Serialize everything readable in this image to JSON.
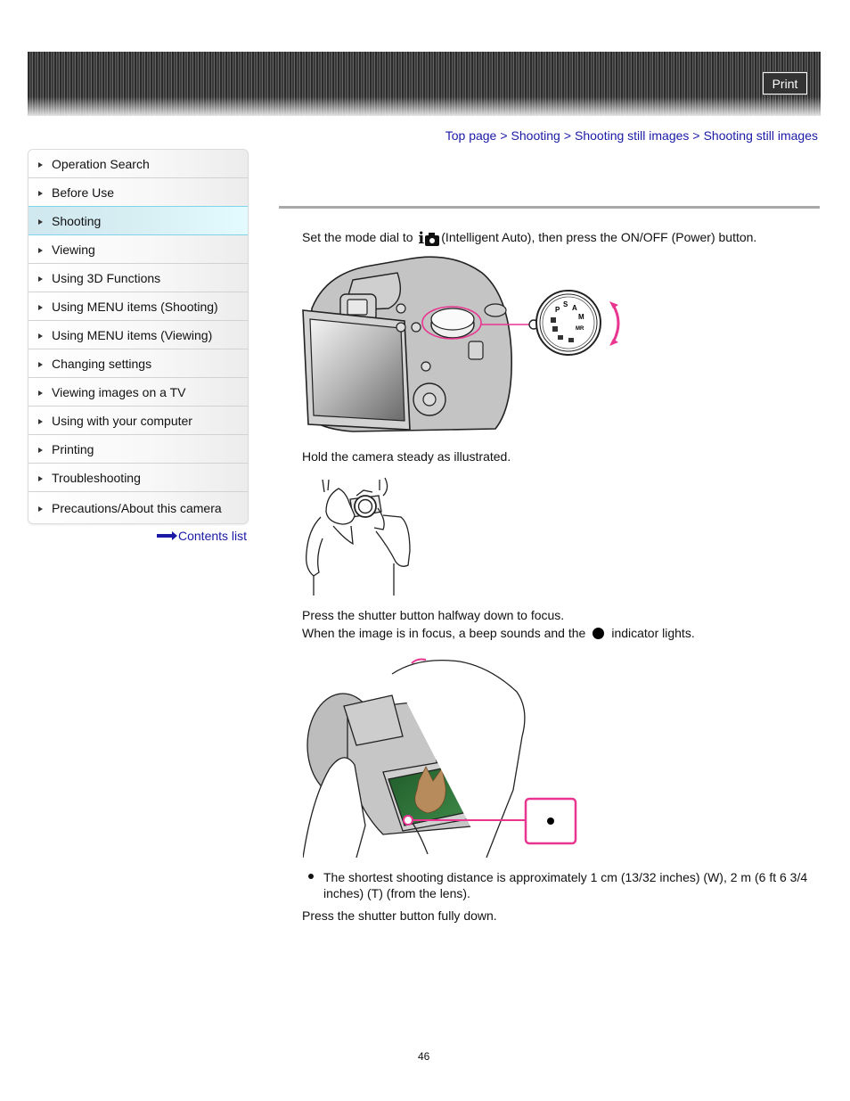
{
  "header": {
    "print_label": "Print"
  },
  "breadcrumb": {
    "items": [
      "Top page",
      "Shooting",
      "Shooting still images",
      "Shooting still images"
    ],
    "separator": ">"
  },
  "sidebar": {
    "items": [
      {
        "label": "Operation Search",
        "active": false
      },
      {
        "label": "Before Use",
        "active": false
      },
      {
        "label": "Shooting",
        "active": true
      },
      {
        "label": "Viewing",
        "active": false
      },
      {
        "label": "Using 3D Functions",
        "active": false
      },
      {
        "label": "Using MENU items (Shooting)",
        "active": false
      },
      {
        "label": "Using MENU items (Viewing)",
        "active": false
      },
      {
        "label": "Changing settings",
        "active": false
      },
      {
        "label": "Viewing images on a TV",
        "active": false
      },
      {
        "label": "Using with your computer",
        "active": false
      },
      {
        "label": "Printing",
        "active": false
      },
      {
        "label": "Troubleshooting",
        "active": false
      },
      {
        "label": "Precautions/About this camera",
        "active": false
      }
    ],
    "contents_link": "Contents list"
  },
  "content": {
    "step1_before": "Set the mode dial to",
    "step1_icon": "intelligent-auto-icon",
    "step1_after": "(Intelligent Auto), then press the ON/OFF (Power) button.",
    "step2": "Hold the camera steady as illustrated.",
    "step3_line1": "Press the shutter button halfway down to focus.",
    "step3_line2_before": "When the image is in focus, a beep sounds and the",
    "step3_line2_after": "indicator lights.",
    "note_line1": "The shortest shooting distance is approximately 1 cm (13/32 inches) (W), 2 m (6 ft 6 3/4",
    "note_line2": "inches) (T) (from the lens).",
    "step4": "Press the shutter button fully down.",
    "figures": {
      "mode_dial": "Camera rear view with mode dial callout",
      "hold_camera": "Person holding camera with both hands",
      "focus": "Camera held in hands with focus indicator callout",
      "dial_labels": [
        "P",
        "S",
        "A",
        "M",
        "MR"
      ]
    },
    "accent_color": "#e8358f"
  },
  "footer": {
    "page_number": "46"
  }
}
